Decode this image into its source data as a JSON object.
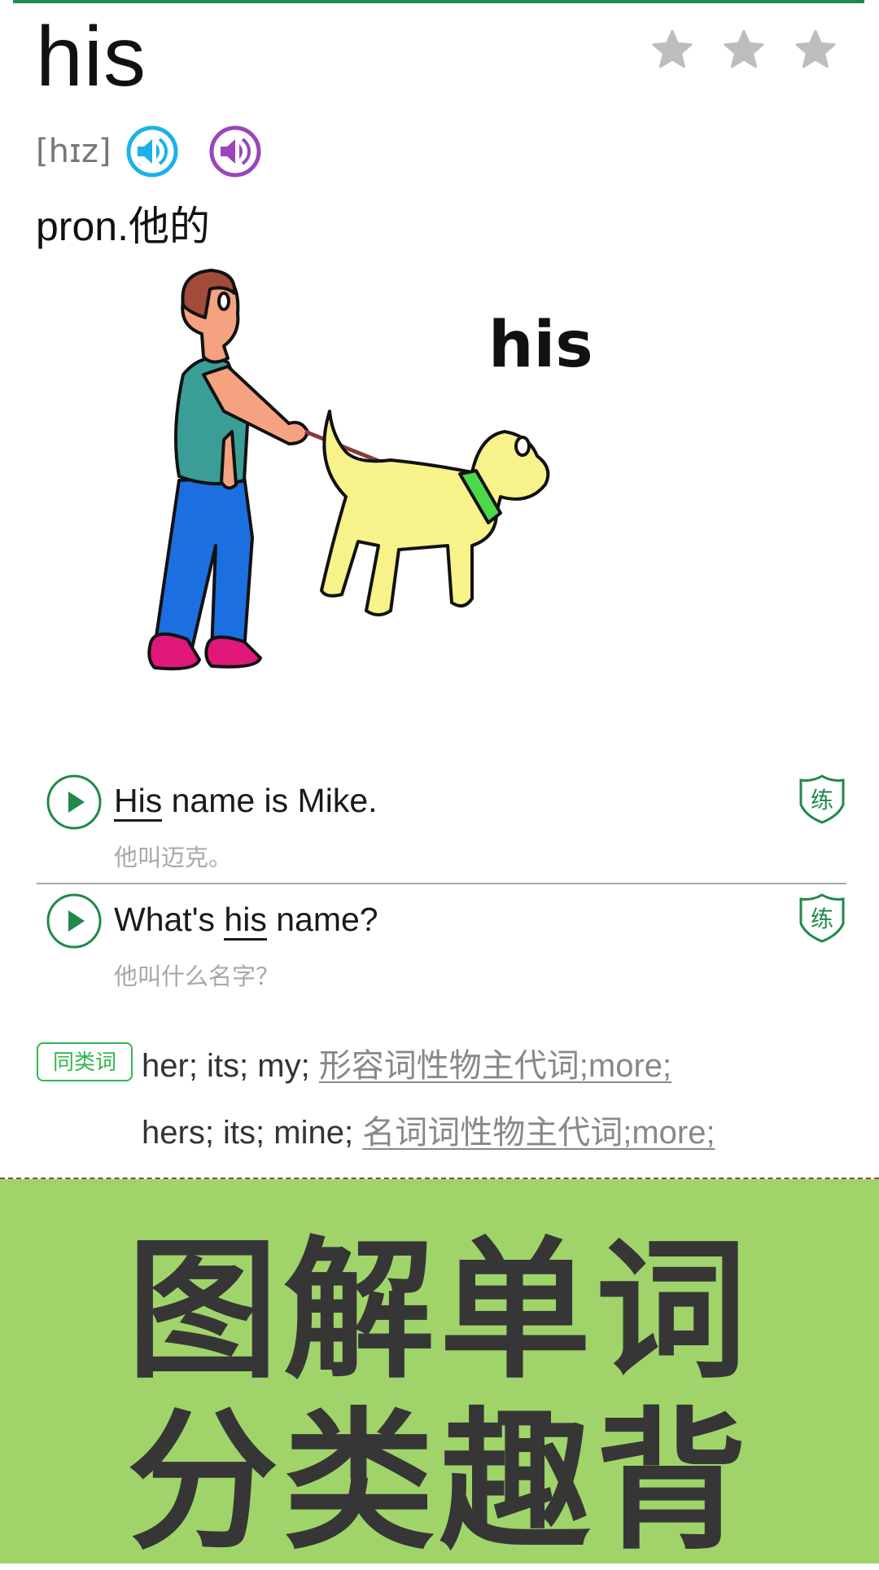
{
  "header": {
    "word": "his",
    "rating": {
      "stars_total": 3,
      "stars_filled": 0
    },
    "phonetic": "[hɪz]",
    "audio": [
      {
        "name": "speaker-uk-icon",
        "color": "#1ab2e8"
      },
      {
        "name": "speaker-us-icon",
        "color": "#9b45b8"
      }
    ],
    "definition": "pron.他的"
  },
  "illustration": {
    "caption": "his",
    "description": "man walking a dog on a leash"
  },
  "examples": [
    {
      "before": "",
      "keyword": "His",
      "after": " name is Mike.",
      "translation": "他叫迈克。",
      "practice_label": "练"
    },
    {
      "before": "What's ",
      "keyword": "his",
      "after": " name?",
      "translation": "他叫什么名字？",
      "practice_label": "练"
    }
  ],
  "synonyms": {
    "badge": "同类词",
    "lines": [
      {
        "words": "her; its; my; ",
        "link": "形容词性物主代词;more;"
      },
      {
        "words": "hers; its; mine; ",
        "link": "名词词性物主代词;more;"
      }
    ]
  },
  "banner": {
    "line1": "图解单词",
    "line2": "分类趣背"
  },
  "colors": {
    "accent": "#1f8a4a",
    "badge_green": "#2fb84e",
    "banner_bg": "#a0d46a",
    "banner_text": "#363636",
    "star": "#bdbdbd"
  }
}
